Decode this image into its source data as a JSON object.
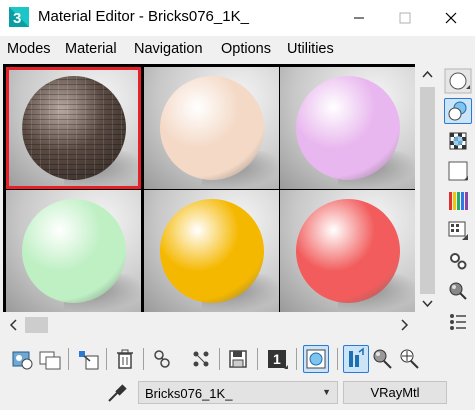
{
  "window": {
    "title": "Material Editor - Bricks076_1K_",
    "app_icon": "3ds-max-icon"
  },
  "menu": {
    "items": [
      "Modes",
      "Material",
      "Navigation",
      "Options",
      "Utilities"
    ]
  },
  "slots": [
    {
      "material": "Bricks076_1K_",
      "sphere_color": "#5a4a42",
      "active": true
    },
    {
      "material": "",
      "sphere_color": "#f4d9c6",
      "active": false
    },
    {
      "material": "",
      "sphere_color": "#e9b7ef",
      "active": false
    },
    {
      "material": "",
      "sphere_color": "#bff0c4",
      "active": false
    },
    {
      "material": "",
      "sphere_color": "#f5b800",
      "active": false
    },
    {
      "material": "",
      "sphere_color": "#f25c5c",
      "active": false
    }
  ],
  "colors": {
    "active_slot_border": "#e81f26",
    "toggle_highlight": "#cce4f7",
    "toggle_border": "#2a7ad5"
  },
  "right_toolbar": [
    "sample-type-sphere-icon",
    "backlight-icon",
    "background-checker-icon",
    "sample-uv-tiling-icon",
    "video-color-check-icon",
    "make-preview-icon",
    "options-icon",
    "select-by-material-icon",
    "material-map-navigator-icon"
  ],
  "bottom_toolbar": [
    "get-material-icon",
    "put-to-scene-icon",
    "assign-to-selection-icon",
    "reset-map-icon",
    "make-unique-icon",
    "put-to-library-icon",
    "material-id-channel-icon",
    "show-shaded-in-viewport-icon",
    "show-end-result-icon",
    "go-to-parent-icon",
    "go-forward-to-sibling-icon"
  ],
  "material_id_channel": "1",
  "material_name": "Bricks076_1K_",
  "material_type": "VRayMtl"
}
